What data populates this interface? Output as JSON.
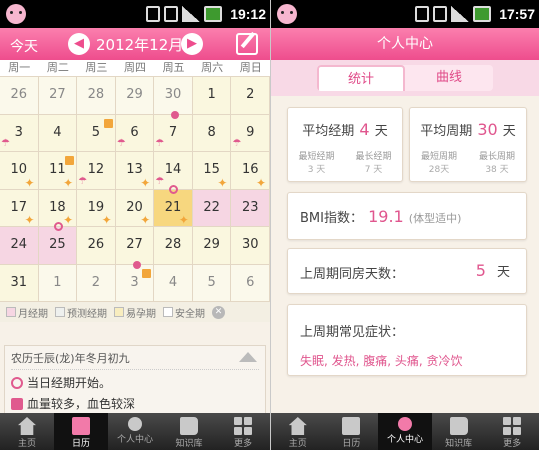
{
  "left": {
    "status_time": "19:12",
    "today_label": "今天",
    "month_label": "2012年12月",
    "weekdays": [
      "周一",
      "周二",
      "周三",
      "周四",
      "周五",
      "周六",
      "周日"
    ],
    "days": [
      [
        "26",
        "27",
        "28",
        "29",
        "30",
        "1",
        "2"
      ],
      [
        "3",
        "4",
        "5",
        "6",
        "7",
        "8",
        "9"
      ],
      [
        "10",
        "11",
        "12",
        "13",
        "14",
        "15",
        "16"
      ],
      [
        "17",
        "18",
        "19",
        "20",
        "21",
        "22",
        "23"
      ],
      [
        "24",
        "25",
        "26",
        "27",
        "28",
        "29",
        "30"
      ],
      [
        "31",
        "1",
        "2",
        "3",
        "4",
        "5",
        "6"
      ]
    ],
    "legend": [
      "月经期",
      "预测经期",
      "易孕期",
      "安全期"
    ],
    "lunar_date": "农历壬辰(龙)年冬月初九",
    "notes": [
      "当日经期开始。",
      "血量较多，血色较深"
    ],
    "nav": [
      "主页",
      "日历",
      "个人中心",
      "知识库",
      "更多"
    ],
    "colors": {
      "accent": "#ee4d8d",
      "period": "#f6d6e3",
      "fertile": "#f8edbf"
    }
  },
  "right": {
    "status_time": "17:57",
    "title": "个人中心",
    "tabs": [
      "统计",
      "曲线"
    ],
    "avg_period": {
      "label": "平均经期",
      "value": "4",
      "unit": "天"
    },
    "avg_cycle": {
      "label": "平均周期",
      "value": "30",
      "unit": "天"
    },
    "shortest_period": {
      "label": "最短经期",
      "value": "3 天"
    },
    "longest_period": {
      "label": "最长经期",
      "value": "7 天"
    },
    "shortest_cycle": {
      "label": "最短周期",
      "value": "28天"
    },
    "longest_cycle": {
      "label": "最长周期",
      "value": "38 天"
    },
    "bmi": {
      "label": "BMI指数：",
      "value": "19.1",
      "note": "(体型适中)"
    },
    "intimacy": {
      "label": "上周期同房天数：",
      "value": "5",
      "unit": "天"
    },
    "symptoms": {
      "label": "上周期常见症状：",
      "value": "失眠, 发热, 腹痛, 头痛, 贪冷饮"
    },
    "nav": [
      "主页",
      "日历",
      "个人中心",
      "知识库",
      "更多"
    ]
  }
}
